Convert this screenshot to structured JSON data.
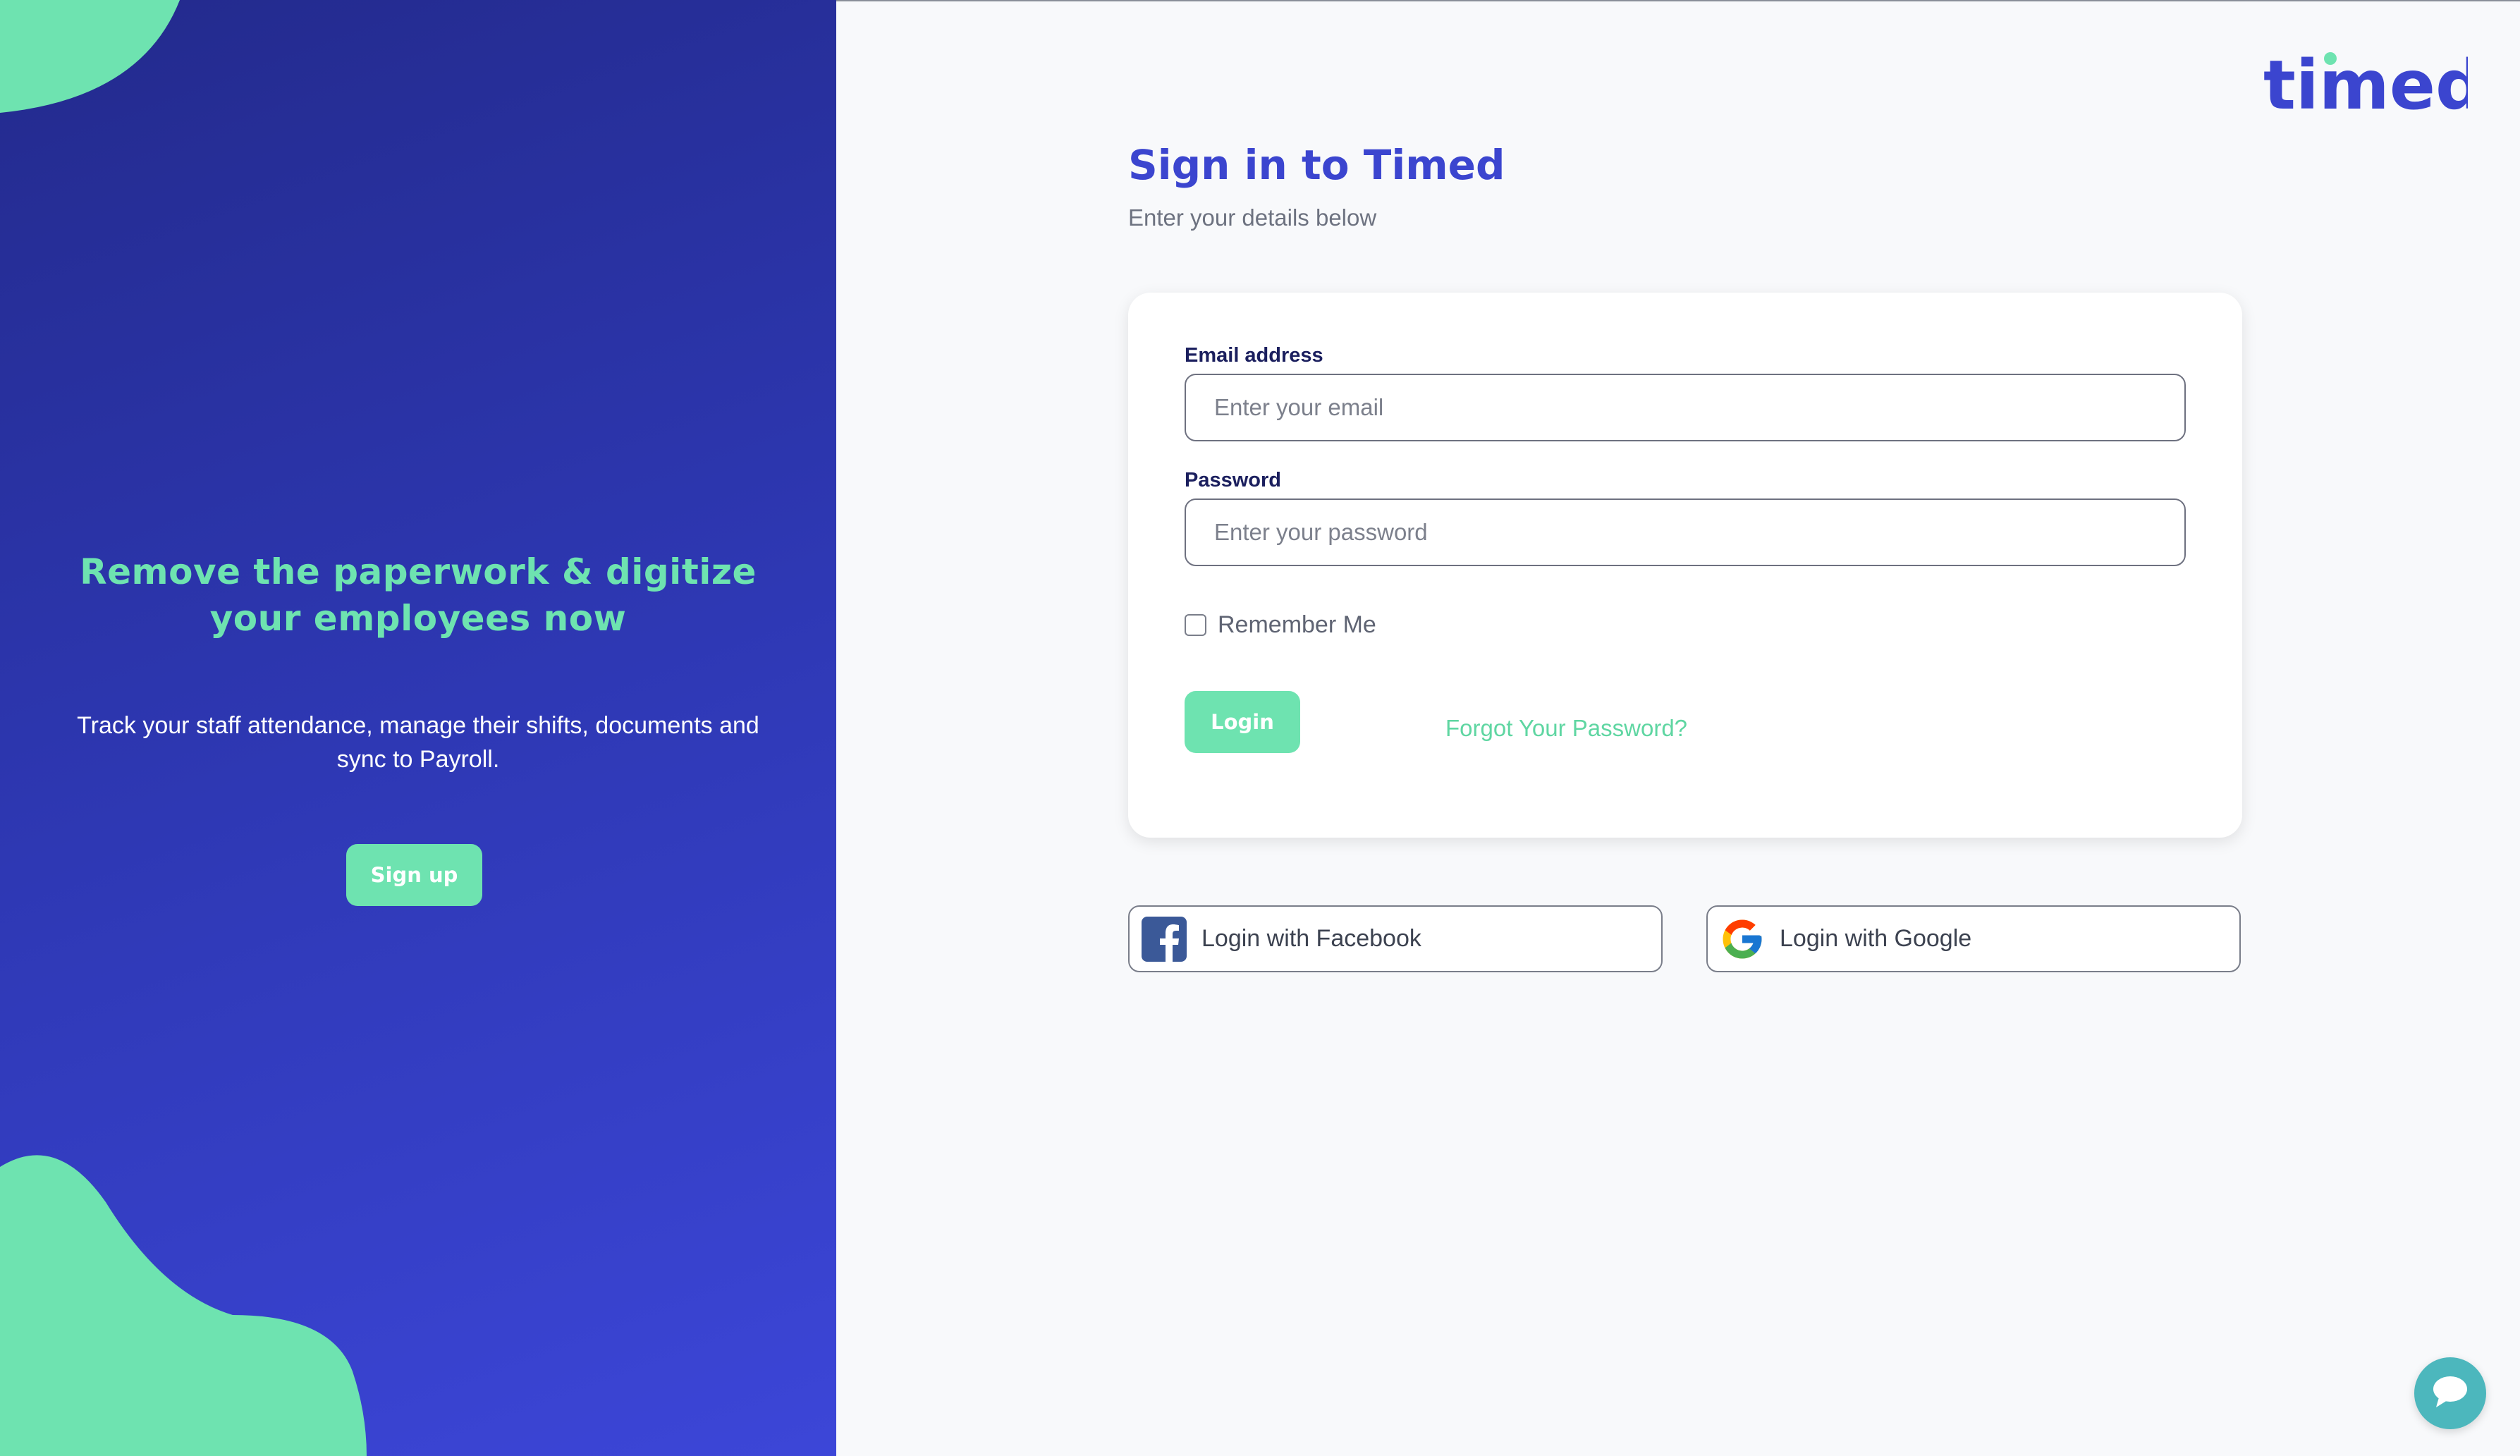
{
  "promo": {
    "title": "Remove the paperwork & digitize your employees now",
    "text": "Track your staff attendance, manage their shifts, documents and sync to Payroll.",
    "signup_label": "Sign up"
  },
  "brand": {
    "logo_text": "timed",
    "logo_color": "#3b45cf",
    "accent_color": "#6ee3b0"
  },
  "header": {
    "title": "Sign in to Timed",
    "subtitle": "Enter your details below"
  },
  "form": {
    "email_label": "Email address",
    "email_placeholder": "Enter your email",
    "email_value": "",
    "password_label": "Password",
    "password_placeholder": "Enter your password",
    "password_value": "",
    "remember_label": "Remember Me",
    "remember_checked": false,
    "login_label": "Login",
    "forgot_label": "Forgot Your Password?"
  },
  "social": {
    "facebook_label": "Login with Facebook",
    "google_label": "Login with Google"
  },
  "icons": {
    "facebook": "facebook-icon",
    "google": "google-icon",
    "chat": "chat-bubble-icon"
  }
}
